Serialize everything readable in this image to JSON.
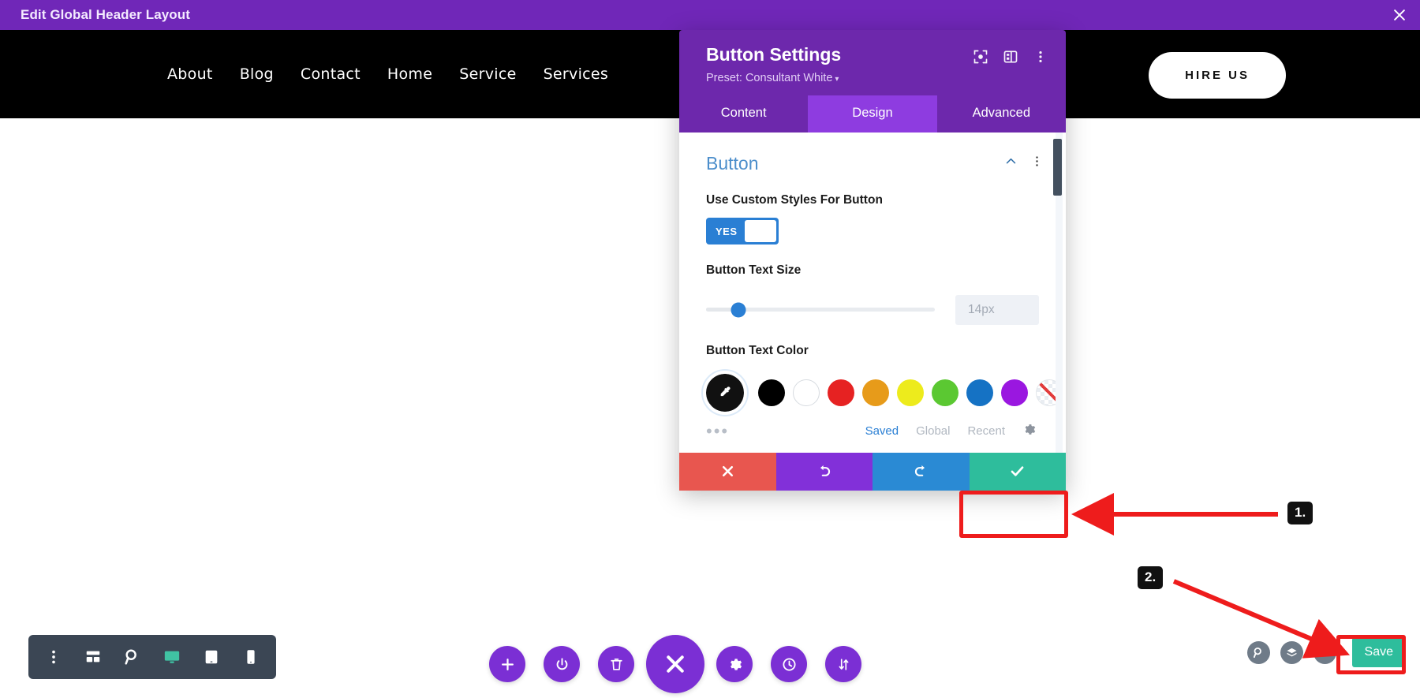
{
  "topbar": {
    "title": "Edit Global Header Layout",
    "close_icon": "close-icon"
  },
  "site_header": {
    "nav_items": [
      {
        "label": "About"
      },
      {
        "label": "Blog"
      },
      {
        "label": "Contact"
      },
      {
        "label": "Home"
      },
      {
        "label": "Service"
      },
      {
        "label": "Services"
      }
    ],
    "cta_label": "HIRE US"
  },
  "modal": {
    "title": "Button Settings",
    "preset": "Preset: Consultant White",
    "preset_caret": "▾",
    "head_icons": [
      "focus-target-icon",
      "layout-panel-icon",
      "more-vertical-icon"
    ],
    "tabs": [
      {
        "label": "Content",
        "active": false
      },
      {
        "label": "Design",
        "active": true
      },
      {
        "label": "Advanced",
        "active": false
      }
    ],
    "section": {
      "title": "Button",
      "collapse_icon": "chevron-up-icon",
      "menu_icon": "more-vertical-icon"
    },
    "fields": {
      "custom_styles": {
        "label": "Use Custom Styles For Button",
        "toggle_value": "YES"
      },
      "text_size": {
        "label": "Button Text Size",
        "value": "14px",
        "slider_percent": 14
      },
      "text_color": {
        "label": "Button Text Color",
        "swatches": [
          {
            "name": "black",
            "hex": "#000000"
          },
          {
            "name": "white",
            "hex": "#ffffff"
          },
          {
            "name": "red",
            "hex": "#e62222"
          },
          {
            "name": "orange",
            "hex": "#e79b1a"
          },
          {
            "name": "yellow",
            "hex": "#edeb1c"
          },
          {
            "name": "green",
            "hex": "#5bc832"
          },
          {
            "name": "blue",
            "hex": "#1572c4"
          },
          {
            "name": "purple",
            "hex": "#9a17e0"
          },
          {
            "name": "transparent",
            "hex": "none"
          }
        ],
        "more_label": "•••",
        "palette_tabs": [
          {
            "label": "Saved",
            "active": true
          },
          {
            "label": "Global",
            "active": false
          },
          {
            "label": "Recent",
            "active": false
          }
        ],
        "settings_icon": "gear-icon"
      }
    },
    "actions": [
      {
        "name": "cancel",
        "icon": "close-icon",
        "color": "#e8564f"
      },
      {
        "name": "undo",
        "icon": "undo-icon",
        "color": "#8230d9"
      },
      {
        "name": "redo",
        "icon": "redo-icon",
        "color": "#2a8ad4"
      },
      {
        "name": "save",
        "icon": "check-icon",
        "color": "#2ebd9c"
      }
    ]
  },
  "annotations": [
    {
      "label": "1."
    },
    {
      "label": "2."
    }
  ],
  "bottom_left_toolbar": {
    "items": [
      {
        "name": "more-vertical-icon",
        "active": false
      },
      {
        "name": "wireframe-icon",
        "active": false
      },
      {
        "name": "zoom-icon",
        "active": false
      },
      {
        "name": "desktop-icon",
        "active": true
      },
      {
        "name": "tablet-icon",
        "active": false
      },
      {
        "name": "phone-icon",
        "active": false
      }
    ]
  },
  "bottom_center_toolbar": {
    "items": [
      {
        "name": "plus-icon",
        "big": false
      },
      {
        "name": "power-icon",
        "big": false
      },
      {
        "name": "trash-icon",
        "big": false
      },
      {
        "name": "close-icon",
        "big": true
      },
      {
        "name": "gear-icon",
        "big": false
      },
      {
        "name": "history-clock-icon",
        "big": false
      },
      {
        "name": "sort-arrows-icon",
        "big": false
      }
    ]
  },
  "bottom_right_toolbar": {
    "items": [
      {
        "name": "search-icon"
      },
      {
        "name": "layers-icon"
      },
      {
        "name": "help-icon"
      }
    ],
    "save_label": "Save",
    "save_color": "#2ebd9c"
  }
}
